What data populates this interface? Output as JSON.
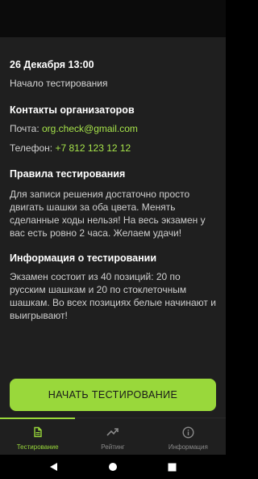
{
  "event": {
    "date": "26 Декабря 13:00",
    "start_label": "Начало тестирования"
  },
  "contacts": {
    "heading": "Контакты организаторов",
    "email_label": "Почта:",
    "email_value": "org.check@gmail.com",
    "phone_label": "Телефон:",
    "phone_value": "+7 812 123 12 12"
  },
  "rules": {
    "heading": "Правила тестирования",
    "text": "Для записи решения достаточно просто двигать шашки за оба цвета. Менять сделанные ходы нельзя! На весь экзамен у вас есть ровно 2 часа. Желаем удачи!"
  },
  "info": {
    "heading": "Информация о тестировании",
    "text": "Экзамен состоит из 40 позиций: 20 по русским шашкам и 20 по стоклеточным шашкам. Во всех позициях белые начинают и выигрывают!"
  },
  "start_button": {
    "label": "НАЧАТЬ ТЕСТИРОВАНИЕ"
  },
  "bottom_nav": {
    "items": [
      {
        "label": "Тестирование",
        "icon": "document-icon",
        "active": true
      },
      {
        "label": "Рейтинг",
        "icon": "trending-up-icon",
        "active": false
      },
      {
        "label": "Информация",
        "icon": "info-icon",
        "active": false
      }
    ]
  },
  "colors": {
    "accent": "#99d83b",
    "link": "#a6e34a",
    "background": "#1f1f1f"
  }
}
